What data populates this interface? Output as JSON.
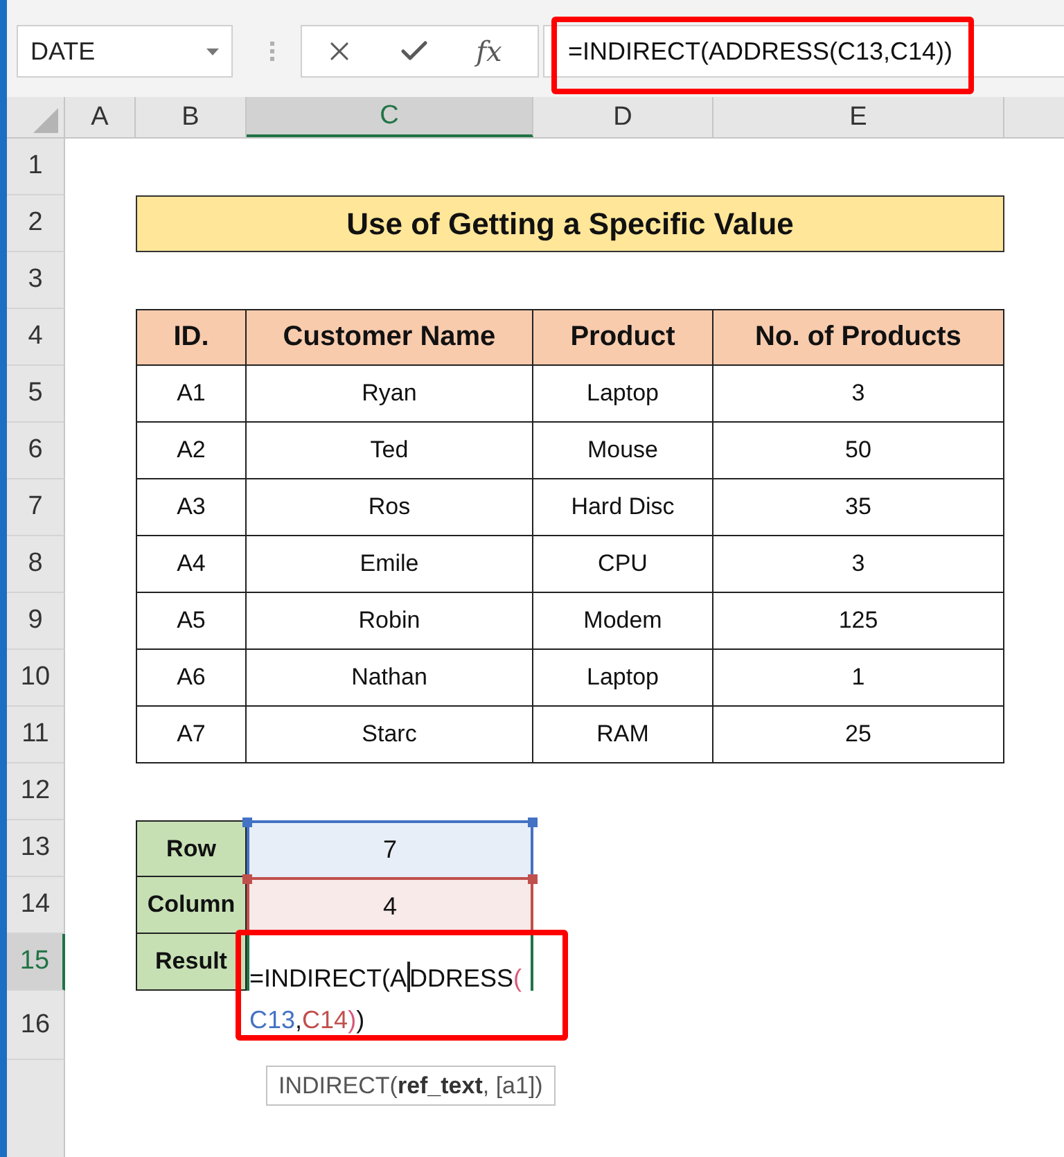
{
  "formula_bar": {
    "name_box": "DATE",
    "buttons": [
      {
        "kind": "cancel"
      },
      {
        "kind": "enter"
      },
      {
        "kind": "function",
        "label": "fx"
      }
    ],
    "formula": "=INDIRECT(ADDRESS(C13,C14))",
    "highlighted": true
  },
  "column_headers": [
    {
      "label": "A",
      "selected": false
    },
    {
      "label": "B",
      "selected": false
    },
    {
      "label": "C",
      "selected": true
    },
    {
      "label": "D",
      "selected": false
    },
    {
      "label": "E",
      "selected": false
    }
  ],
  "row_headers": [
    {
      "label": "1",
      "selected": false
    },
    {
      "label": "2",
      "selected": false
    },
    {
      "label": "3",
      "selected": false
    },
    {
      "label": "4",
      "selected": false
    },
    {
      "label": "5",
      "selected": false
    },
    {
      "label": "6",
      "selected": false
    },
    {
      "label": "7",
      "selected": false
    },
    {
      "label": "8",
      "selected": false
    },
    {
      "label": "9",
      "selected": false
    },
    {
      "label": "10",
      "selected": false
    },
    {
      "label": "11",
      "selected": false
    },
    {
      "label": "12",
      "selected": false
    },
    {
      "label": "13",
      "selected": false
    },
    {
      "label": "14",
      "selected": false
    },
    {
      "label": "15",
      "selected": true
    },
    {
      "label": "16",
      "selected": false
    }
  ],
  "title": "Use of Getting a Specific Value",
  "table": {
    "columns": [
      "ID.",
      "Customer Name",
      "Product",
      "No. of Products"
    ],
    "rows": [
      [
        "A1",
        "Ryan",
        "Laptop",
        "3"
      ],
      [
        "A2",
        "Ted",
        "Mouse",
        "50"
      ],
      [
        "A3",
        "Ros",
        "Hard Disc",
        "35"
      ],
      [
        "A4",
        "Emile",
        "CPU",
        "3"
      ],
      [
        "A5",
        "Robin",
        "Modem",
        "125"
      ],
      [
        "A6",
        "Nathan",
        "Laptop",
        "1"
      ],
      [
        "A7",
        "Starc",
        "RAM",
        "25"
      ]
    ]
  },
  "lookup": {
    "rows": [
      {
        "kind": "reference",
        "label": "Row",
        "value": "7",
        "color": "#4472c4"
      },
      {
        "kind": "reference",
        "label": "Column",
        "value": "4",
        "color": "#c0504d"
      },
      {
        "kind": "editing",
        "label": "Result"
      }
    ]
  },
  "cell_editor": {
    "highlighted": true,
    "lines": [
      [
        {
          "kind": "text",
          "text": "=INDIRECT(A"
        },
        {
          "kind": "caret"
        },
        {
          "kind": "text",
          "text": "DDRESS"
        },
        {
          "kind": "text",
          "text": "(",
          "color": "#d9587a"
        }
      ],
      [
        {
          "kind": "text",
          "text": "C13",
          "color": "#4472c4"
        },
        {
          "kind": "text",
          "text": ","
        },
        {
          "kind": "text",
          "text": "C14",
          "color": "#c0504d"
        },
        {
          "kind": "text",
          "text": ")",
          "color": "#d9587a"
        },
        {
          "kind": "text",
          "text": ")"
        }
      ]
    ]
  },
  "tooltip": {
    "text": "INDIRECT(**ref_text**, [a1])"
  }
}
